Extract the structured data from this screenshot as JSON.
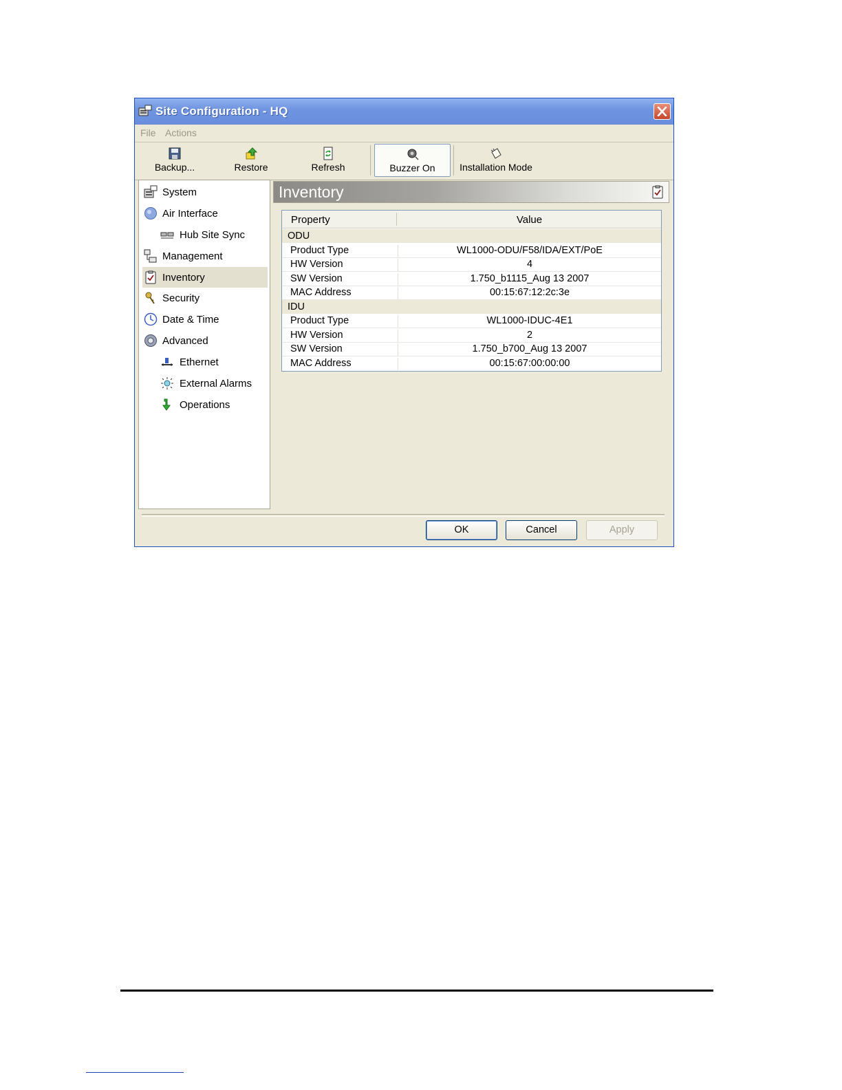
{
  "window": {
    "title": "Site Configuration - HQ"
  },
  "menu": {
    "file": "File",
    "actions": "Actions"
  },
  "toolbar": {
    "backup": "Backup...",
    "restore": "Restore",
    "refresh": "Refresh",
    "buzzer": "Buzzer On",
    "installation": "Installation Mode"
  },
  "nav": {
    "items": [
      {
        "label": "System",
        "icon": "system-icon"
      },
      {
        "label": "Air Interface",
        "icon": "air-interface-icon"
      },
      {
        "label": "Hub Site Sync",
        "icon": "hub-sync-icon"
      },
      {
        "label": "Management",
        "icon": "management-icon"
      },
      {
        "label": "Inventory",
        "icon": "inventory-icon",
        "selected": true
      },
      {
        "label": "Security",
        "icon": "security-icon"
      },
      {
        "label": "Date & Time",
        "icon": "clock-icon"
      },
      {
        "label": "Advanced",
        "icon": "gear-icon"
      },
      {
        "label": "Ethernet",
        "icon": "ethernet-icon"
      },
      {
        "label": "External Alarms",
        "icon": "alarm-icon"
      },
      {
        "label": "Operations",
        "icon": "arrow-down-icon"
      }
    ]
  },
  "panel": {
    "title": "Inventory"
  },
  "grid": {
    "headers": {
      "property": "Property",
      "value": "Value"
    },
    "groups": [
      {
        "name": "ODU",
        "rows": [
          {
            "property": "Product Type",
            "value": "WL1000-ODU/F58/IDA/EXT/PoE"
          },
          {
            "property": "HW Version",
            "value": "4"
          },
          {
            "property": "SW Version",
            "value": "1.750_b1115_Aug 13 2007"
          },
          {
            "property": "MAC Address",
            "value": "00:15:67:12:2c:3e"
          }
        ]
      },
      {
        "name": "IDU",
        "rows": [
          {
            "property": "Product Type",
            "value": "WL1000-IDUC-4E1"
          },
          {
            "property": "HW Version",
            "value": "2"
          },
          {
            "property": "SW Version",
            "value": "1.750_b700_Aug 13 2007"
          },
          {
            "property": "MAC Address",
            "value": "00:15:67:00:00:00"
          }
        ]
      }
    ]
  },
  "buttons": {
    "ok": "OK",
    "cancel": "Cancel",
    "apply": "Apply"
  },
  "colors": {
    "titlebar": "#6e93e0",
    "window_bg": "#ece9d8",
    "close": "#c8452b"
  }
}
